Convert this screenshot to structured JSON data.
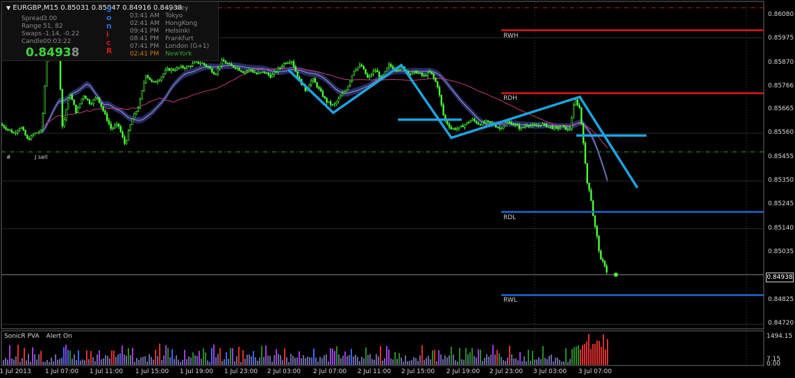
{
  "header": {
    "title": "EURGBP,M15  0.85031 0.85047 0.84916 0.84938"
  },
  "info_panel": {
    "rows": [
      {
        "label": "Spread",
        "value": "3.00"
      },
      {
        "label": "Range",
        "value": "51, 82"
      },
      {
        "label": "Swaps",
        "value": "-1.14, -0.22"
      },
      {
        "label": "Candle",
        "value": "00:03:22"
      }
    ],
    "big_price_main": "0.8493",
    "big_price_last": "8",
    "sonic_letters": [
      {
        "char": "S",
        "color": "#1e6fd8"
      },
      {
        "char": "o",
        "color": "#1e6fd8"
      },
      {
        "char": "n",
        "color": "#1e6fd8"
      },
      {
        "char": "i",
        "color": "#d01818"
      },
      {
        "char": "c",
        "color": "#d01818"
      },
      {
        "char": "R",
        "color": "#d01818"
      }
    ],
    "sessions": [
      {
        "time": "",
        "city": "Sydney"
      },
      {
        "time": "03:41 AM",
        "city": "Tokyo"
      },
      {
        "time": "02:41 AM",
        "city": "HongKong"
      },
      {
        "time": "09:41 PM",
        "city": "Helsinki"
      },
      {
        "time": "08:41 PM",
        "city": "Frankfurt"
      },
      {
        "time": "07:41 PM",
        "city": "London  (G+1)"
      },
      {
        "time": "02:41 PM",
        "city": "NewYork",
        "active": true
      }
    ]
  },
  "colors": {
    "bull_candle": "#4cff38",
    "bear_candle": "#4cff38",
    "pattern_line": "#1fa3e0",
    "resistance": "#e01818",
    "support": "#1c6ad8",
    "ma_band": "#2a2e68",
    "ma_pink": "#c83a7a",
    "grid": "#1c1c1c",
    "dash_red": "#c02020",
    "dash_green": "#33aa33"
  },
  "levels": [
    {
      "label": "RWH",
      "price": 0.86013
    },
    {
      "label": "RDH",
      "price": 0.85736
    },
    {
      "label": "RDL",
      "price": 0.85214
    },
    {
      "label": "RWL",
      "price": 0.84848
    }
  ],
  "trade_labels": [
    "#",
    "J sell"
  ],
  "current_price": "0.84938",
  "sub_window": {
    "title": "SonicR PVA",
    "alert": "Alert On",
    "max_label": "1494.15",
    "min_label": "0.00",
    "extra_label": "7.15"
  },
  "chart_data": {
    "type": "candlestick",
    "symbol": "EURGBP",
    "timeframe": "M15",
    "ylim": [
      0.847,
      0.8614
    ],
    "y_ticks": [
      "0.86080",
      "0.85975",
      "0.85870",
      "0.85766",
      "0.85665",
      "0.85560",
      "0.85455",
      "0.85350",
      "0.85245",
      "0.85140",
      "0.85035",
      "0.84930",
      "0.84825",
      "0.84720"
    ],
    "x_ticks": [
      "1 Jul 2013",
      "1 Jul 07:00",
      "1 Jul 11:00",
      "1 Jul 15:00",
      "1 Jul 19:00",
      "1 Jul 23:00",
      "2 Jul 03:00",
      "2 Jul 07:00",
      "2 Jul 11:00",
      "2 Jul 15:00",
      "2 Jul 19:00",
      "2 Jul 23:00",
      "3 Jul 03:00",
      "3 Jul 07:00"
    ],
    "close_path": [
      [
        0,
        0.856
      ],
      [
        10,
        0.8558
      ],
      [
        20,
        0.8556
      ],
      [
        30,
        0.8559
      ],
      [
        40,
        0.8553
      ],
      [
        50,
        0.8556
      ],
      [
        60,
        0.8557
      ],
      [
        70,
        0.86
      ],
      [
        78,
        0.86
      ],
      [
        85,
        0.8588
      ],
      [
        90,
        0.8558
      ],
      [
        100,
        0.8574
      ],
      [
        110,
        0.8565
      ],
      [
        120,
        0.8573
      ],
      [
        130,
        0.8569
      ],
      [
        140,
        0.8572
      ],
      [
        150,
        0.8565
      ],
      [
        160,
        0.8558
      ],
      [
        170,
        0.856
      ],
      [
        180,
        0.8551
      ],
      [
        190,
        0.8562
      ],
      [
        200,
        0.8568
      ],
      [
        210,
        0.8582
      ],
      [
        220,
        0.8578
      ],
      [
        230,
        0.858
      ],
      [
        240,
        0.8584
      ],
      [
        250,
        0.8584
      ],
      [
        260,
        0.8585
      ],
      [
        270,
        0.8585
      ],
      [
        280,
        0.8587
      ],
      [
        290,
        0.8587
      ],
      [
        300,
        0.8585
      ],
      [
        310,
        0.8582
      ],
      [
        320,
        0.8588
      ],
      [
        330,
        0.8586
      ],
      [
        340,
        0.8585
      ],
      [
        350,
        0.8583
      ],
      [
        360,
        0.8584
      ],
      [
        370,
        0.8582
      ],
      [
        380,
        0.8583
      ],
      [
        390,
        0.8581
      ],
      [
        400,
        0.8584
      ],
      [
        410,
        0.8587
      ],
      [
        420,
        0.8588
      ],
      [
        430,
        0.858
      ],
      [
        440,
        0.8575
      ],
      [
        450,
        0.858
      ],
      [
        460,
        0.8575
      ],
      [
        470,
        0.857
      ],
      [
        480,
        0.8568
      ],
      [
        490,
        0.8572
      ],
      [
        500,
        0.8576
      ],
      [
        510,
        0.8584
      ],
      [
        520,
        0.8586
      ],
      [
        530,
        0.858
      ],
      [
        540,
        0.8584
      ],
      [
        550,
        0.858
      ],
      [
        560,
        0.8586
      ],
      [
        570,
        0.8584
      ],
      [
        580,
        0.8585
      ],
      [
        590,
        0.8582
      ],
      [
        600,
        0.8583
      ],
      [
        610,
        0.8581
      ],
      [
        620,
        0.8583
      ],
      [
        630,
        0.8577
      ],
      [
        640,
        0.8562
      ],
      [
        650,
        0.8558
      ],
      [
        660,
        0.8558
      ],
      [
        670,
        0.856
      ],
      [
        680,
        0.8562
      ],
      [
        690,
        0.856
      ],
      [
        700,
        0.8561
      ],
      [
        710,
        0.856
      ],
      [
        720,
        0.8558
      ],
      [
        730,
        0.8561
      ],
      [
        740,
        0.856
      ],
      [
        750,
        0.8558
      ],
      [
        760,
        0.856
      ],
      [
        770,
        0.8559
      ],
      [
        780,
        0.856
      ],
      [
        790,
        0.8559
      ],
      [
        800,
        0.8558
      ],
      [
        810,
        0.8559
      ],
      [
        820,
        0.8557
      ],
      [
        828,
        0.8571
      ],
      [
        835,
        0.8567
      ],
      [
        840,
        0.8553
      ],
      [
        845,
        0.8535
      ],
      [
        850,
        0.853
      ],
      [
        855,
        0.8518
      ],
      [
        860,
        0.851
      ],
      [
        865,
        0.85
      ],
      [
        870,
        0.8499
      ],
      [
        875,
        0.8494
      ]
    ],
    "pattern_lines": [
      [
        [
          415,
          0.8584
        ],
        [
          480,
          0.8565
        ],
        [
          578,
          0.8586
        ],
        [
          650,
          0.8554
        ],
        [
          835,
          0.8572
        ],
        [
          918,
          0.8532
        ]
      ],
      [
        [
          573,
          0.8562
        ],
        [
          665,
          0.8562
        ]
      ],
      [
        [
          830,
          0.8555
        ],
        [
          931,
          0.8555
        ]
      ]
    ],
    "volume_max": 1494.15
  }
}
